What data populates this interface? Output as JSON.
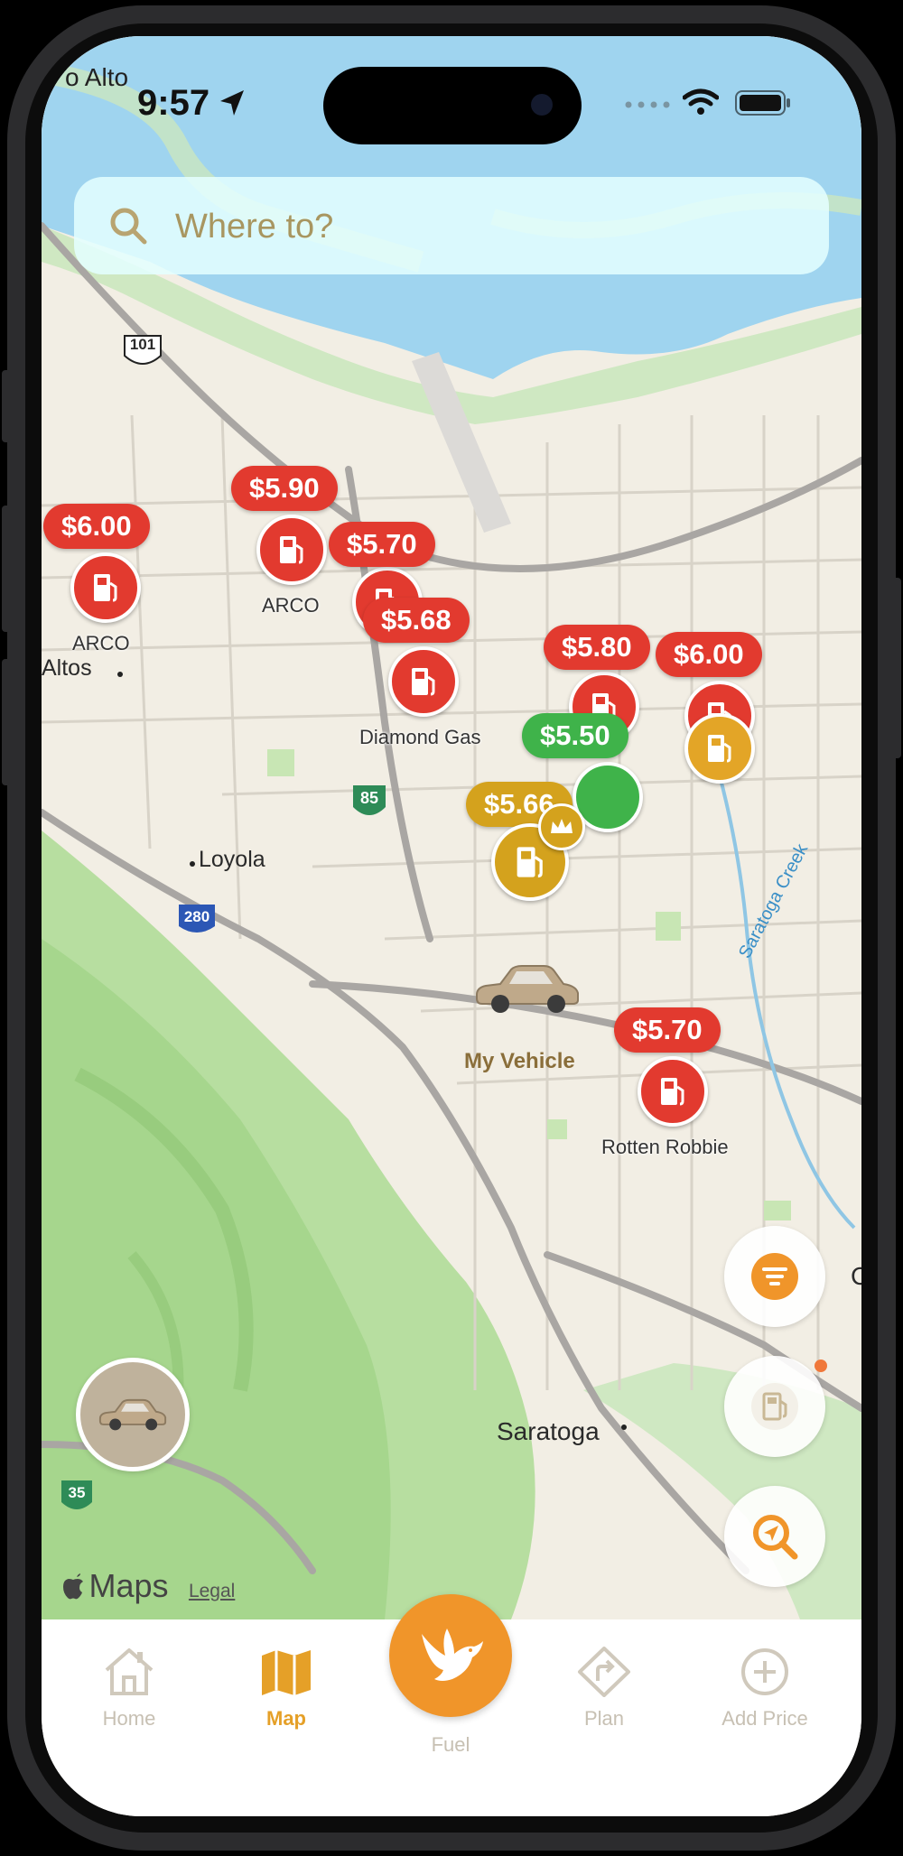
{
  "status_bar": {
    "city_fragment": "o Alto",
    "time": "9:57"
  },
  "search": {
    "placeholder": "Where to?"
  },
  "map": {
    "places": {
      "altos": "Altos",
      "loyola": "Loyola",
      "saratoga": "Saratoga",
      "saratoga_creek": "Saratoga Creek",
      "edge_letter": "C"
    },
    "highway_shields": {
      "us101": "101",
      "ca85": "85",
      "i280": "280",
      "ca35": "35"
    },
    "vehicle_label": "My Vehicle",
    "attribution": {
      "brand": "Maps",
      "legal": "Legal"
    }
  },
  "stations": [
    {
      "price": "$6.00",
      "name": "ARCO",
      "tier": "red"
    },
    {
      "price": "$5.90",
      "name": "ARCO",
      "tier": "red"
    },
    {
      "price": "$5.70",
      "name": "",
      "tier": "red"
    },
    {
      "price": "$5.68",
      "name": "Diamond Gas",
      "tier": "red"
    },
    {
      "price": "$5.80",
      "name": "",
      "tier": "red"
    },
    {
      "price": "$6.00",
      "name": "",
      "tier": "red"
    },
    {
      "price": "$5.50",
      "name": "",
      "tier": "green"
    },
    {
      "price": "$5.66",
      "name": "",
      "tier": "gold"
    },
    {
      "price": "$5.70",
      "name": "Rotten Robbie",
      "tier": "red"
    }
  ],
  "tabs": [
    {
      "label": "Home",
      "icon": "home-icon"
    },
    {
      "label": "Map",
      "icon": "map-icon",
      "active": true
    },
    {
      "label": "Fuel",
      "icon": "bird-icon"
    },
    {
      "label": "Plan",
      "icon": "directions-icon"
    },
    {
      "label": "Add Price",
      "icon": "plus-circle-icon"
    }
  ],
  "colors": {
    "accent": "#F0952A",
    "price_red": "#E23A2F",
    "price_green": "#3FB34A",
    "price_gold": "#D4A21D"
  }
}
